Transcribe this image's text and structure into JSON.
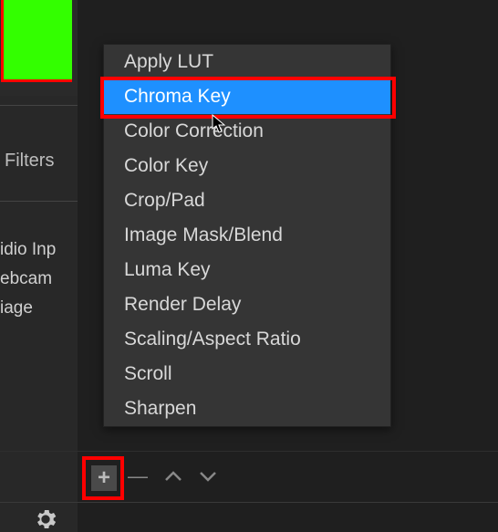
{
  "left_panel": {
    "filters_label": "Filters",
    "sources": [
      "idio Inp",
      "ebcam",
      "iage"
    ]
  },
  "context_menu": {
    "items": [
      {
        "label": "Apply LUT",
        "highlighted": false
      },
      {
        "label": "Chroma Key",
        "highlighted": true
      },
      {
        "label": "Color Correction",
        "highlighted": false
      },
      {
        "label": "Color Key",
        "highlighted": false
      },
      {
        "label": "Crop/Pad",
        "highlighted": false
      },
      {
        "label": "Image Mask/Blend",
        "highlighted": false
      },
      {
        "label": "Luma Key",
        "highlighted": false
      },
      {
        "label": "Render Delay",
        "highlighted": false
      },
      {
        "label": "Scaling/Aspect Ratio",
        "highlighted": false
      },
      {
        "label": "Scroll",
        "highlighted": false
      },
      {
        "label": "Sharpen",
        "highlighted": false
      }
    ]
  },
  "toolbar": {
    "add": "+",
    "remove": "—"
  }
}
